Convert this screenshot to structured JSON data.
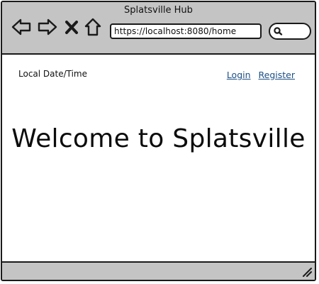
{
  "window": {
    "title": "Splatsville Hub"
  },
  "toolbar": {
    "back_icon": "back-arrow-icon",
    "forward_icon": "forward-arrow-icon",
    "stop_icon": "close-x-icon",
    "home_icon": "home-icon",
    "address_url": "https://localhost:8080/home",
    "search_icon": "search-icon"
  },
  "header": {
    "local_datetime_label": "Local Date/Time",
    "login_link": "Login",
    "register_link": "Register"
  },
  "main": {
    "welcome_heading": "Welcome to Splatsville"
  },
  "status_bar": {
    "resize_icon": "resize-grip-icon"
  },
  "colors": {
    "chrome_background": "#c4c4c4",
    "border": "#1a1a1a",
    "link": "#1b4f86",
    "page_background": "#ffffff"
  }
}
